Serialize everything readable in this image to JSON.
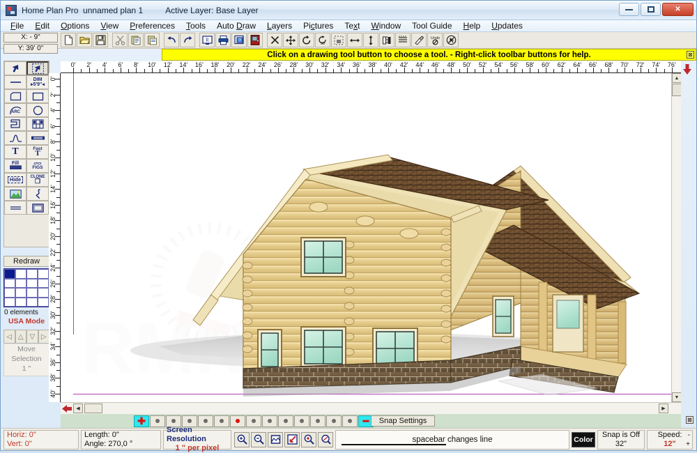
{
  "window": {
    "app_title": "Home Plan Pro",
    "document_title": "unnamed plan 1",
    "active_layer": "Active Layer: Base Layer",
    "minimize_label": "Minimize",
    "maximize_label": "Maximize",
    "close_label": "✕"
  },
  "menu": [
    {
      "label": "File",
      "accel": "F"
    },
    {
      "label": "Edit",
      "accel": "E"
    },
    {
      "label": "Options",
      "accel": "O"
    },
    {
      "label": "View",
      "accel": "V"
    },
    {
      "label": "Preferences",
      "accel": "P"
    },
    {
      "label": "Tools",
      "accel": "T"
    },
    {
      "label": "Auto Draw",
      "accel": "D"
    },
    {
      "label": "Layers",
      "accel": "L"
    },
    {
      "label": "Pictures",
      "accel": "c"
    },
    {
      "label": "Text",
      "accel": "x"
    },
    {
      "label": "Window",
      "accel": "W"
    },
    {
      "label": "Tool Guide",
      "accel": ""
    },
    {
      "label": "Help",
      "accel": "H"
    },
    {
      "label": "Updates",
      "accel": "U"
    }
  ],
  "coords": {
    "x_value": "X: - 9\"",
    "y_value": "Y: 39' 0\""
  },
  "toolbar": [
    {
      "name": "new-file-icon",
      "glyph": "page"
    },
    {
      "name": "open-folder-icon",
      "glyph": "folder"
    },
    {
      "name": "save-disk-icon",
      "glyph": "disk"
    },
    {
      "name": "cut-scissors-icon",
      "glyph": "scissors"
    },
    {
      "name": "copy-icon",
      "glyph": "copy"
    },
    {
      "name": "paste-icon",
      "glyph": "paste"
    },
    {
      "name": "undo-icon",
      "glyph": "undo"
    },
    {
      "name": "redo-icon",
      "glyph": "redo"
    },
    {
      "name": "redraw-screen-icon",
      "glyph": "monitor"
    },
    {
      "name": "print-icon",
      "glyph": "printer"
    },
    {
      "name": "print-preview-help-icon",
      "glyph": "preview"
    },
    {
      "name": "door-icon",
      "glyph": "door"
    },
    {
      "name": "delete-x-icon",
      "glyph": "xmark"
    },
    {
      "name": "move-icon",
      "glyph": "move"
    },
    {
      "name": "rotate-icon",
      "glyph": "rotate"
    },
    {
      "name": "rotate-90-icon",
      "glyph": "rot90"
    },
    {
      "name": "select-box-icon",
      "glyph": "selbox"
    },
    {
      "name": "stretch-horizontal-icon",
      "glyph": "harrow"
    },
    {
      "name": "stretch-vertical-icon",
      "glyph": "varrow"
    },
    {
      "name": "mirror-icon",
      "glyph": "mirror"
    },
    {
      "name": "align-icon",
      "glyph": "align"
    },
    {
      "name": "paint-icon",
      "glyph": "paint"
    },
    {
      "name": "undo-last-icon",
      "glyph": "undolast"
    },
    {
      "name": "no-select-icon",
      "glyph": "nosel"
    }
  ],
  "hint": {
    "text": "Click on a drawing tool button to choose a tool.  -  Right-click toolbar buttons for help.",
    "close_label": "⊠"
  },
  "palette": [
    {
      "name": "select-arrow-tool",
      "label": "",
      "glyph": "arrow",
      "selected": false
    },
    {
      "name": "select-area-tool",
      "label": "",
      "glyph": "arrowdash",
      "selected": true
    },
    {
      "name": "line-tool",
      "label": "",
      "glyph": "line",
      "selected": false
    },
    {
      "name": "dimension-tool",
      "label": "DIM",
      "glyph": "dim",
      "selected": false
    },
    {
      "name": "polyline-tool",
      "label": "",
      "glyph": "poly",
      "selected": false
    },
    {
      "name": "rectangle-tool",
      "label": "",
      "glyph": "rect",
      "selected": false
    },
    {
      "name": "arc-tool",
      "label": "ARC",
      "glyph": "arc",
      "selected": false
    },
    {
      "name": "circle-tool",
      "label": "",
      "glyph": "circle",
      "selected": false
    },
    {
      "name": "wall-tool",
      "label": "",
      "glyph": "wall",
      "selected": false
    },
    {
      "name": "window-tool",
      "label": "",
      "glyph": "window",
      "selected": false
    },
    {
      "name": "curve-tool",
      "label": "",
      "glyph": "curve",
      "selected": false
    },
    {
      "name": "double-line-tool",
      "label": "",
      "glyph": "dbline",
      "selected": false
    },
    {
      "name": "text-tool",
      "label": "T",
      "glyph": "text",
      "selected": false
    },
    {
      "name": "fast-text-tool",
      "label": "Fast",
      "glyph": "fasttext",
      "selected": false
    },
    {
      "name": "fill-tool",
      "label": "Fill",
      "glyph": "fill",
      "selected": false
    },
    {
      "name": "figures-tool",
      "label": "FIGS",
      "glyph": "figs",
      "selected": false
    },
    {
      "name": "hide-tool",
      "label": "Hide",
      "glyph": "hide",
      "selected": false
    },
    {
      "name": "clone-tool",
      "label": "CLONE",
      "glyph": "clone",
      "selected": false
    },
    {
      "name": "picture-tool",
      "label": "",
      "glyph": "picture",
      "selected": false
    },
    {
      "name": "freehand-tool",
      "label": "",
      "glyph": "freehand",
      "selected": false
    },
    {
      "name": "double-rule-tool",
      "label": "",
      "glyph": "drule",
      "selected": false
    },
    {
      "name": "box-tool",
      "label": "",
      "glyph": "box",
      "selected": false
    }
  ],
  "sidepanel": {
    "redraw_label": "Redraw",
    "element_count": "0 elements",
    "mode_label": "USA Mode",
    "move_selection_label": "Move\nSelection",
    "move_selection_amount": "1 \"",
    "arrows": [
      "◁",
      "△",
      "▽",
      "▷"
    ],
    "swatch_selected_color": "#0b1a8c"
  },
  "rulers": {
    "unit": "'",
    "h_start": 0,
    "h_end": 78,
    "h_step": 2,
    "v_start": 0,
    "v_end": 40,
    "v_step": 2
  },
  "canvas": {
    "drawing_title": "log-cabin-3d-render",
    "background": "#ffffff",
    "page_boundary_color": "#b13fb1"
  },
  "lineweight": {
    "plus_label": "✚",
    "minus_label": "━",
    "dot_count": 13,
    "selected_index": 5,
    "snap_settings_label": "Snap Settings",
    "close_label": "⊠"
  },
  "statusbar": {
    "horiz_label": "Horiz: 0\"",
    "vert_label": "Vert: 0\"",
    "length_label": "Length:  0\"",
    "angle_label": "Angle:  270,0 °",
    "resolution_title": "Screen Resolution",
    "resolution_value": "1 \" per pixel",
    "line_hint": "spacebar changes line",
    "color_button": "Color",
    "snap_title": "Snap is Off",
    "snap_value": "32\"",
    "speed_title": "Speed:",
    "speed_value": "12\"",
    "speed_inc": "+",
    "speed_dec": "-",
    "zoom_buttons": [
      {
        "name": "zoom-in-icon"
      },
      {
        "name": "zoom-out-icon"
      },
      {
        "name": "zoom-fit-page-icon"
      },
      {
        "name": "zoom-window-icon"
      },
      {
        "name": "zoom-selection-icon"
      },
      {
        "name": "zoom-previous-icon"
      }
    ]
  }
}
